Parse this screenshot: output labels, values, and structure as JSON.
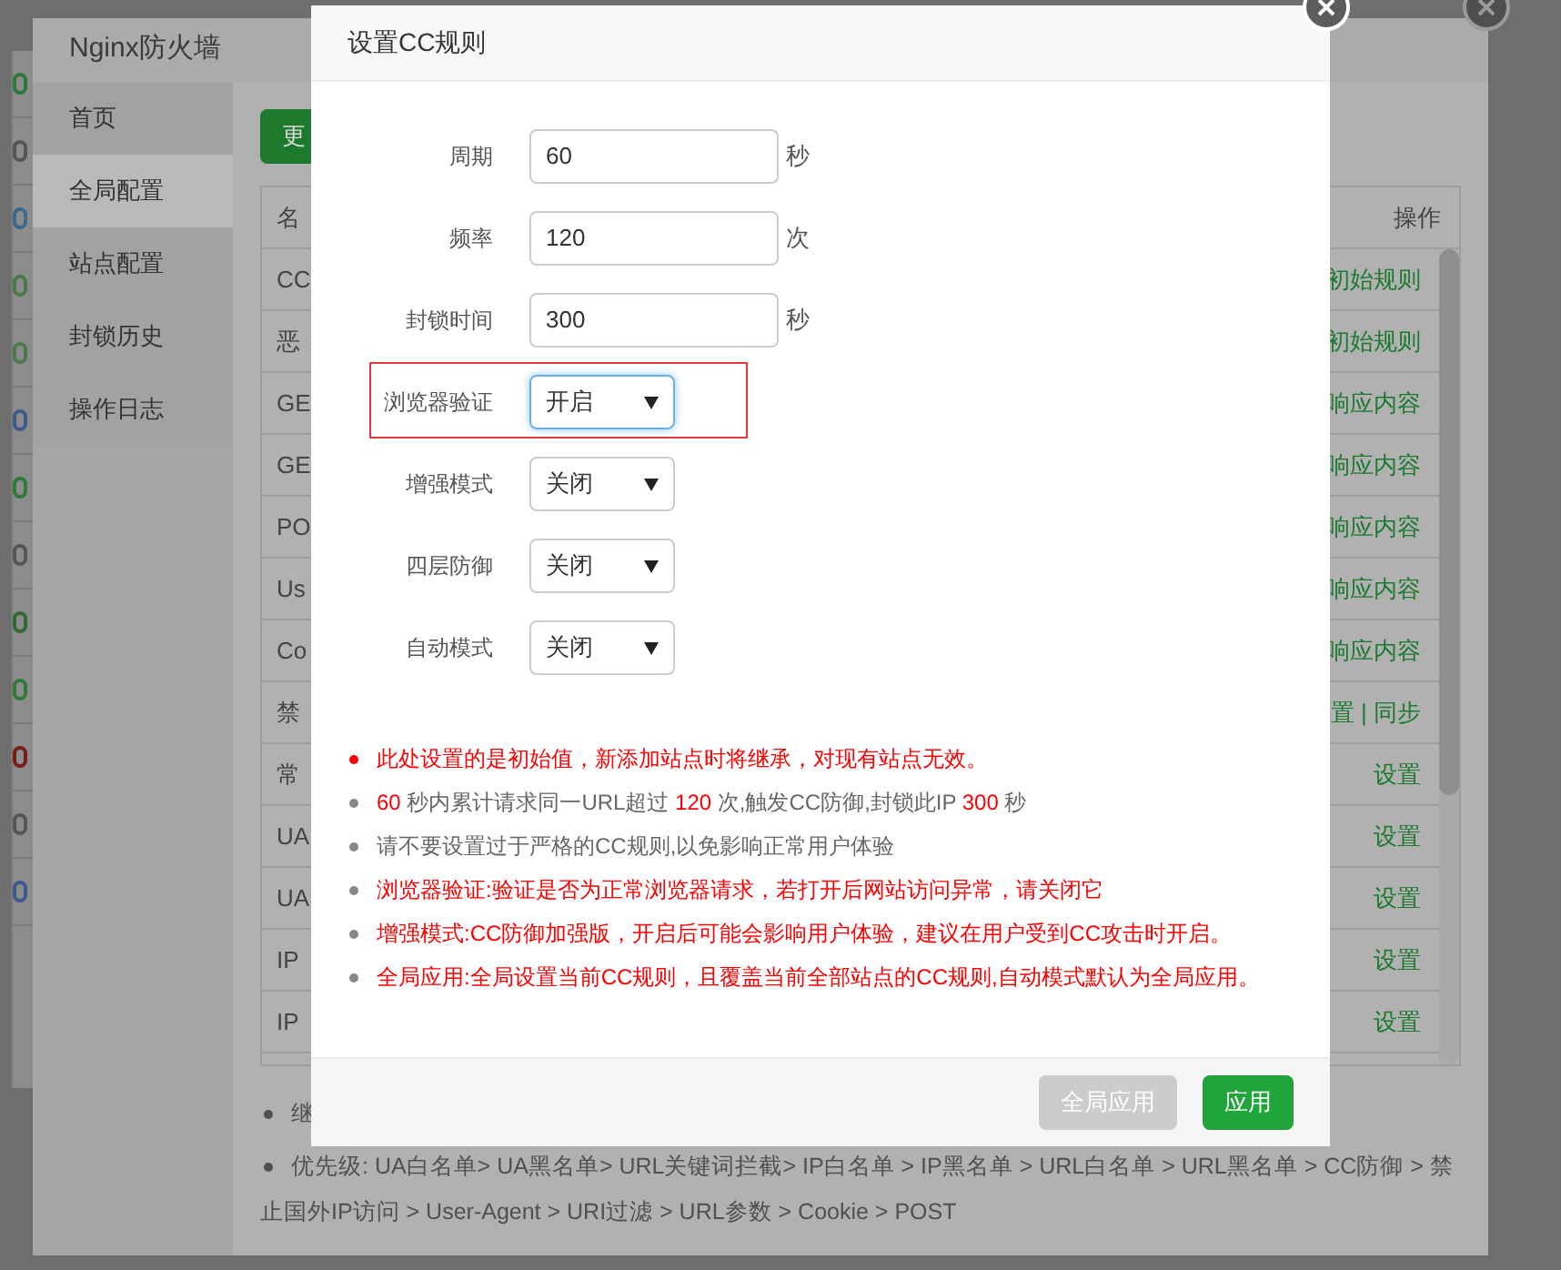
{
  "window": {
    "title": "Nginx防火墙"
  },
  "sidebar": {
    "items": [
      {
        "label": "首页",
        "selected": false
      },
      {
        "label": "全局配置",
        "selected": true
      },
      {
        "label": "站点配置",
        "selected": false
      },
      {
        "label": "封锁历史",
        "selected": false
      },
      {
        "label": "操作日志",
        "selected": false
      }
    ]
  },
  "toolbar": {
    "button": "更"
  },
  "table": {
    "columns": [
      "名",
      "操作"
    ],
    "rows": [
      {
        "name": "CC",
        "action": "初始规则"
      },
      {
        "name": "恶",
        "action": "初始规则"
      },
      {
        "name": "GE",
        "action": "响应内容"
      },
      {
        "name": "GE",
        "action": "响应内容"
      },
      {
        "name": "PO",
        "action": "响应内容"
      },
      {
        "name": "Us",
        "action": "响应内容"
      },
      {
        "name": "Co",
        "action": "响应内容"
      },
      {
        "name": "禁",
        "action": "置 | 同步"
      },
      {
        "name": "常",
        "action": "设置"
      },
      {
        "name": "UA",
        "action": "设置"
      },
      {
        "name": "UA",
        "action": "设置"
      },
      {
        "name": "IP",
        "action": "设置"
      },
      {
        "name": "IP",
        "action": "设置"
      }
    ]
  },
  "footnotes": [
    "继",
    "优先级: UA白名单> UA黑名单> URL关键词拦截> IP白名单 > IP黑名单 > URL白名单 > URL黑名单 > CC防御 > 禁止国外IP访问 > User-Agent > URI过滤 > URL参数 > Cookie > POST"
  ],
  "dialog": {
    "title": "设置CC规则",
    "fields": [
      {
        "kind": "input",
        "label": "周期",
        "value": "60",
        "unit": "秒",
        "highlighted": false
      },
      {
        "kind": "input",
        "label": "频率",
        "value": "120",
        "unit": "次",
        "highlighted": false
      },
      {
        "kind": "input",
        "label": "封锁时间",
        "value": "300",
        "unit": "秒",
        "highlighted": false
      },
      {
        "kind": "select",
        "label": "浏览器验证",
        "value": "开启",
        "highlighted": true
      },
      {
        "kind": "select",
        "label": "增强模式",
        "value": "关闭",
        "highlighted": false
      },
      {
        "kind": "select",
        "label": "四层防御",
        "value": "关闭",
        "highlighted": false
      },
      {
        "kind": "select",
        "label": "自动模式",
        "value": "关闭",
        "highlighted": false
      }
    ],
    "notes": [
      {
        "kind": "warning",
        "segments": [
          {
            "text": "此处设置的是初始值，新添加站点时将继承，对现有站点无效。",
            "highlight": true
          }
        ]
      },
      {
        "kind": "info",
        "segments": [
          {
            "text": "60",
            "highlight": true
          },
          {
            "text": " 秒内累计请求同一URL超过 ",
            "highlight": false
          },
          {
            "text": "120",
            "highlight": true
          },
          {
            "text": " 次,触发CC防御,封锁此IP ",
            "highlight": false
          },
          {
            "text": "300",
            "highlight": true
          },
          {
            "text": " 秒",
            "highlight": false
          }
        ]
      },
      {
        "kind": "info",
        "segments": [
          {
            "text": "请不要设置过于严格的CC规则,以免影响正常用户体验",
            "highlight": false
          }
        ]
      },
      {
        "kind": "info",
        "segments": [
          {
            "text": "浏览器验证:验证是否为正常浏览器请求，若打开后网站访问异常，请关闭它",
            "highlight": true
          }
        ]
      },
      {
        "kind": "info",
        "segments": [
          {
            "text": "增强模式:CC防御加强版，开启后可能会影响用户体验，建议在用户受到CC攻击时开启。",
            "highlight": true
          }
        ]
      },
      {
        "kind": "info",
        "segments": [
          {
            "text": "全局应用:全局设置当前CC规则，且覆盖当前全部站点的CC规则,自动模式默认为全局应用。",
            "highlight": true
          }
        ]
      }
    ],
    "buttons": [
      {
        "label": "全局应用",
        "disabled": true
      },
      {
        "label": "应用",
        "disabled": false
      }
    ]
  }
}
